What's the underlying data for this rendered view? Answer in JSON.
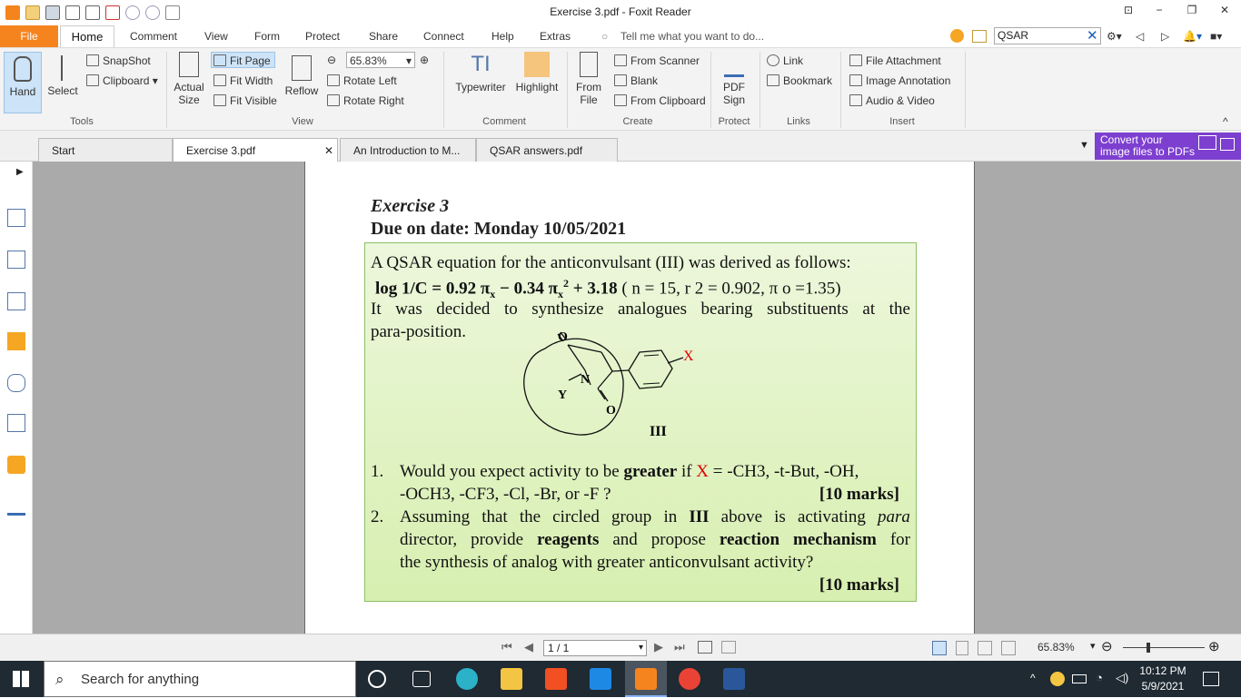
{
  "window": {
    "title": "Exercise 3.pdf - Foxit Reader",
    "controls": [
      "⊡",
      "−",
      "❐",
      "✕"
    ]
  },
  "menu": {
    "file": "File",
    "tabs": [
      "Home",
      "Comment",
      "View",
      "Form",
      "Protect",
      "Share",
      "Connect",
      "Help",
      "Extras"
    ],
    "tell_me": "Tell me what you want to do...",
    "search_value": "QSAR"
  },
  "ribbon": {
    "tools": {
      "hand": "Hand",
      "select": "Select",
      "snapshot": "SnapShot",
      "clipboard": "Clipboard",
      "group": "Tools"
    },
    "view": {
      "actual_size_1": "Actual",
      "actual_size_2": "Size",
      "fit_page": "Fit Page",
      "fit_width": "Fit Width",
      "fit_visible": "Fit Visible",
      "reflow": "Reflow",
      "zoom": "65.83%",
      "rotate_left": "Rotate Left",
      "rotate_right": "Rotate Right",
      "group": "View"
    },
    "comment": {
      "typewriter": "Typewriter",
      "highlight": "Highlight",
      "group": "Comment"
    },
    "create": {
      "from_file_1": "From",
      "from_file_2": "File",
      "from_scanner": "From Scanner",
      "blank": "Blank",
      "from_clipboard": "From Clipboard",
      "group": "Create"
    },
    "protect": {
      "pdf_sign_1": "PDF",
      "pdf_sign_2": "Sign",
      "group": "Protect"
    },
    "links": {
      "link": "Link",
      "bookmark": "Bookmark",
      "group": "Links"
    },
    "insert": {
      "file_attachment": "File Attachment",
      "image_annotation": "Image Annotation",
      "audio_video": "Audio & Video",
      "group": "Insert"
    }
  },
  "doc_tabs": [
    "Start",
    "Exercise 3.pdf",
    "An Introduction to M...",
    "QSAR answers.pdf"
  ],
  "ad": {
    "line1": "Convert your",
    "line2": "image files to PDFs"
  },
  "document": {
    "title": "Exercise 3",
    "due": "Due on date: Monday 10/05/2021",
    "intro_line1": "A QSAR equation for the anticonvulsant (III) was derived as follows:",
    "equation_bold": "log 1/C = 0.92 π",
    "equation_x1": "x",
    "equation_mid": " − 0.34 π",
    "equation_x2": "x",
    "equation_sup": "2",
    "equation_bold2": " + 3.18",
    "equation_stats": " ( n = 15, r 2 = 0.902,  π o =1.35)",
    "intro_line3_words": [
      "It",
      "was",
      "decided",
      "to",
      "synthesize",
      "analogues",
      "bearing",
      "substituents",
      "at",
      "the"
    ],
    "intro_line4": "para-position.",
    "structure_label": "III",
    "atom_o1": "O",
    "atom_o2": "O",
    "atom_n": "N",
    "atom_y": "Y",
    "atom_x": "X",
    "q1_num": "1.",
    "q1_line1": "Would you expect activity to be greater if X = -CH3, -t-But, -OH,",
    "q1_line2": "-OCH3, -CF3, -Cl, -Br, or -F ?",
    "q1_marks": "[10 marks]",
    "q2_num": "2.",
    "q2_line1": "Assuming that the circled group in III above is activating para",
    "q2_line2": "director, provide reagents and propose reaction mechanism for",
    "q2_line3": "the synthesis of analog with greater anticonvulsant activity?",
    "q2_marks": "[10 marks]"
  },
  "statusbar": {
    "page": "1 / 1",
    "zoom": "65.83%"
  },
  "taskbar": {
    "search": "Search for anything",
    "time": "10:12 PM",
    "date": "5/9/2021"
  },
  "colors": {
    "accent": "#f5841f",
    "x_red": "#e00000",
    "green_box": "#d7efb0",
    "ad_purple": "#7d3fd0"
  }
}
